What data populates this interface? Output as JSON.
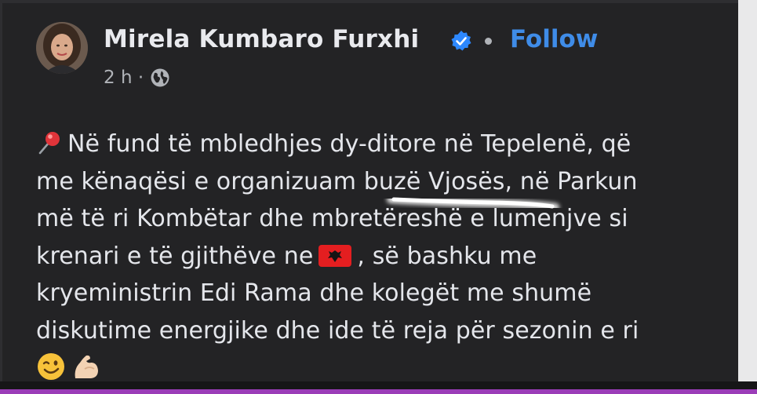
{
  "post": {
    "author": "Mirela Kumbaro Furxhi",
    "follow_label": "Follow",
    "timestamp": "2 h ·",
    "lines": [
      "Në fund të mbledhjes dy-ditore në Tepelenë, që",
      "me kënaqësi e organizuam buzë Vjosës, në Parkun",
      "më të ri Kombëtar dhe mbretëreshë e lumenjve si",
      "krenari e të gjithëve ne",
      ", së bashku me",
      "kryeministrin Edi Rama dhe kolegët me shumë",
      "diskutime energjike dhe ide të reja për sezonin e ri"
    ]
  },
  "icons": {
    "verified": "verified-badge-icon",
    "audience": "globe-icon",
    "pin": "round-pushpin-emoji",
    "flag": "albania-flag-emoji",
    "wink": "winking-face-emoji",
    "muscle": "flexed-biceps-emoji"
  },
  "colors": {
    "background": "#232325",
    "text": "#e4e6eb",
    "follow": "#3f8ce8",
    "muted": "#b0b3b8",
    "bottom_bar": "#9b3db8"
  }
}
